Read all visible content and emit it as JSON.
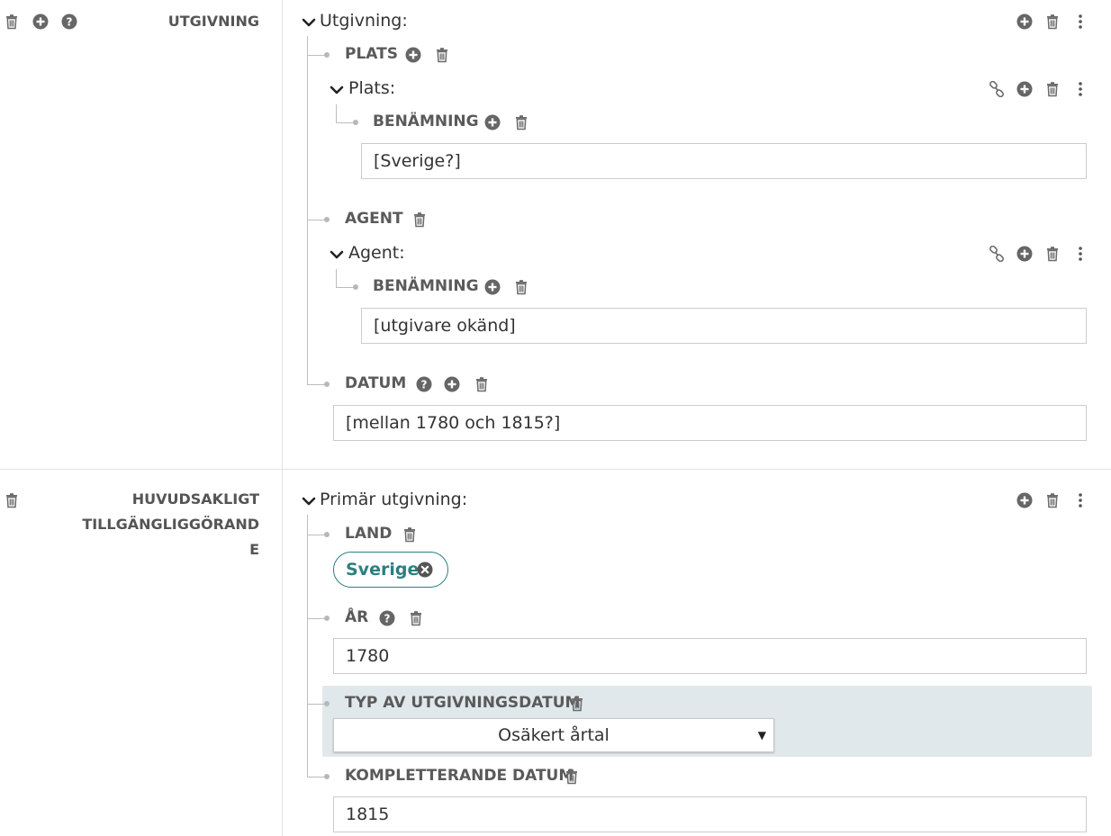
{
  "colors": {
    "accent": "#2b7f7f",
    "icon": "#6a6a6a",
    "highlight": "#e1e8ec"
  },
  "section1": {
    "label": "UTGIVNING",
    "entity_title": "Utgivning:",
    "plats": {
      "label": "PLATS",
      "entity_title": "Plats:",
      "benamning_label": "BENÄMNING",
      "value": "[Sverige?]"
    },
    "agent": {
      "label": "AGENT",
      "entity_title": "Agent:",
      "benamning_label": "BENÄMNING",
      "value": "[utgivare okänd]"
    },
    "datum": {
      "label": "DATUM",
      "value": "[mellan 1780 och 1815?]"
    }
  },
  "section2": {
    "label_line1": "HUVUDSAKLIGT",
    "label_line2": "TILLGÄNGLIGGÖRAND",
    "label_line3": "E",
    "entity_title": "Primär utgivning:",
    "land": {
      "label": "LAND",
      "chip": "Sverige"
    },
    "ar": {
      "label": "ÅR",
      "value": "1780"
    },
    "typ": {
      "label": "TYP AV UTGIVNINGSDATUM",
      "selected": "Osäkert årtal"
    },
    "kompletterande": {
      "label": "KOMPLETTERANDE DATUM",
      "value": "1815"
    }
  },
  "icons": {
    "trash": "trash-icon",
    "plus": "plus-circle-icon",
    "help": "help-circle-icon",
    "more": "kebab-menu-icon",
    "link": "link-icon",
    "chevron": "chevron-down-icon",
    "remove": "remove-chip-icon"
  }
}
